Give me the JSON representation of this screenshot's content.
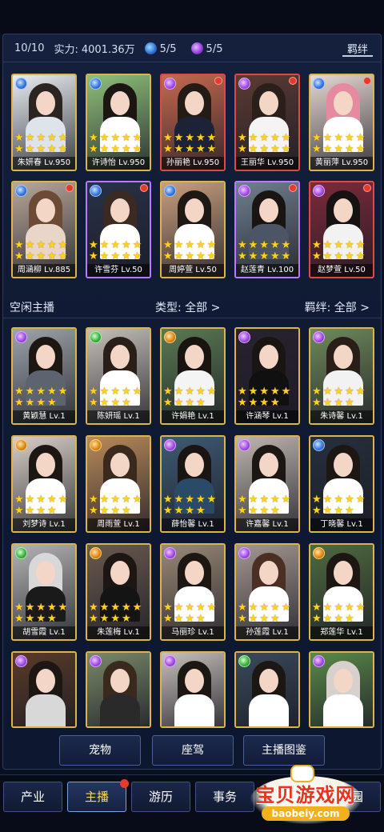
{
  "stats": {
    "count": "10/10",
    "power_label": "实力:",
    "power_value": "4001.36万",
    "blue_count": "5/5",
    "purple_count": "5/5",
    "bond_button": "羁绊"
  },
  "team": [
    {
      "name": "朱妍春 Lv.950",
      "frame": "gold",
      "element": "blue",
      "dot": false,
      "stars": 10,
      "palette": [
        "#e9eef2",
        "#2c2420",
        "#dfe3ea"
      ]
    },
    {
      "name": "许诗怡 Lv.950",
      "frame": "gold",
      "element": "blue",
      "dot": false,
      "stars": 10,
      "palette": [
        "#8fc07a",
        "#1c1612",
        "#ffffff"
      ]
    },
    {
      "name": "孙丽艳 Lv.950",
      "frame": "red",
      "element": "purple",
      "dot": true,
      "stars": 10,
      "palette": [
        "#c56a4e",
        "#241a16",
        "#1d2236"
      ]
    },
    {
      "name": "王丽华 Lv.950",
      "frame": "red",
      "element": "purple",
      "dot": true,
      "stars": 10,
      "palette": [
        "#5a3b33",
        "#2a1f1a",
        "#f4f4f4"
      ]
    },
    {
      "name": "黄丽萍 Lv.950",
      "frame": "gold",
      "element": "blue",
      "dot": true,
      "stars": 10,
      "palette": [
        "#e7d8d2",
        "#e58ba0",
        "#ffffff"
      ]
    },
    {
      "name": "周涵柳 Lv.885",
      "frame": "gold",
      "element": "blue",
      "dot": true,
      "stars": 10,
      "palette": [
        "#b9a89a",
        "#6b4a36",
        "#e9d6c8"
      ]
    },
    {
      "name": "许雪芬 Lv.50",
      "frame": "purple",
      "element": "blue",
      "dot": true,
      "stars": 10,
      "palette": [
        "#283247",
        "#3a2a22",
        "#ffffff"
      ]
    },
    {
      "name": "周婷萱 Lv.50",
      "frame": "gold",
      "element": "blue",
      "dot": false,
      "stars": 10,
      "palette": [
        "#c9a07e",
        "#1e1814",
        "#ffffff"
      ]
    },
    {
      "name": "赵莲青 Lv.100",
      "frame": "purple",
      "element": "purple",
      "dot": true,
      "stars": 10,
      "palette": [
        "#70808f",
        "#1a1512",
        "#4b5566"
      ]
    },
    {
      "name": "赵梦萱 Lv.50",
      "frame": "red",
      "element": "purple",
      "dot": true,
      "stars": 10,
      "palette": [
        "#7d2a3a",
        "#161212",
        "#f2f2f2"
      ]
    }
  ],
  "section": {
    "idle_label": "空闲主播",
    "type_filter": "类型: 全部 >",
    "bond_filter": "羁绊: 全部 >"
  },
  "idle": [
    {
      "name": "黄颖慧 Lv.1",
      "frame": "gold",
      "element": "purple",
      "stars": 9,
      "palette": [
        "#9fa5aa",
        "#1d1714",
        "#5d6470"
      ]
    },
    {
      "name": "陈妍瑶 Lv.1",
      "frame": "gold",
      "element": "green",
      "stars": 9,
      "palette": [
        "#c6c0b8",
        "#2a1f18",
        "#ffffff"
      ]
    },
    {
      "name": "许娟艳 Lv.1",
      "frame": "gold",
      "element": "orange",
      "stars": 9,
      "palette": [
        "#5a7a52",
        "#1a1411",
        "#f4f4f4"
      ]
    },
    {
      "name": "许涵琴 Lv.1",
      "frame": "gold",
      "element": "purple",
      "stars": 9,
      "palette": [
        "#2a2230",
        "#1a1412",
        "#101010"
      ]
    },
    {
      "name": "朱诗馨 Lv.1",
      "frame": "gold",
      "element": "purple",
      "stars": 9,
      "palette": [
        "#6f8a5a",
        "#2a1e18",
        "#f2f2f2"
      ]
    },
    {
      "name": "刘梦诗 Lv.1",
      "frame": "gold",
      "element": "orange",
      "stars": 9,
      "palette": [
        "#d8cfc6",
        "#1d1714",
        "#ffffff"
      ]
    },
    {
      "name": "周雨萱 Lv.1",
      "frame": "gold",
      "element": "orange",
      "stars": 9,
      "palette": [
        "#b98a5a",
        "#3a2a1e",
        "#ffffff"
      ]
    },
    {
      "name": "薛怡馨 Lv.1",
      "frame": "gold",
      "element": "purple",
      "stars": 9,
      "palette": [
        "#3f5a73",
        "#1a1512",
        "#2b4a6a"
      ]
    },
    {
      "name": "许嘉馨 Lv.1",
      "frame": "gold",
      "element": "purple",
      "stars": 9,
      "palette": [
        "#bfb6ad",
        "#1d1714",
        "#ffffff"
      ]
    },
    {
      "name": "丁晓馨 Lv.1",
      "frame": "gold",
      "element": "blue",
      "stars": 9,
      "palette": [
        "#25303c",
        "#1d1714",
        "#ffffff"
      ]
    },
    {
      "name": "胡雪霞 Lv.1",
      "frame": "gold",
      "element": "green",
      "stars": 9,
      "palette": [
        "#b4b4b4",
        "#d8d8d8",
        "#1a1a1a"
      ]
    },
    {
      "name": "朱莲梅 Lv.1",
      "frame": "gold",
      "element": "orange",
      "stars": 9,
      "palette": [
        "#6a5a4e",
        "#1d1714",
        "#141414"
      ]
    },
    {
      "name": "马丽珍 Lv.1",
      "frame": "gold",
      "element": "purple",
      "stars": 9,
      "palette": [
        "#9a8a76",
        "#1d1714",
        "#ffffff"
      ]
    },
    {
      "name": "孙莲霞 Lv.1",
      "frame": "gold",
      "element": "purple",
      "stars": 9,
      "palette": [
        "#a49890",
        "#4a2f22",
        "#ffffff"
      ]
    },
    {
      "name": "郑莲华 Lv.1",
      "frame": "gold",
      "element": "orange",
      "stars": 9,
      "palette": [
        "#4f6a3f",
        "#1d1714",
        "#ffffff"
      ]
    },
    {
      "name": "",
      "frame": "gold",
      "element": "purple",
      "stars": 0,
      "palette": [
        "#5a3b2a",
        "#1d1714",
        "#d8d8d8"
      ]
    },
    {
      "name": "",
      "frame": "gold",
      "element": "purple",
      "stars": 0,
      "palette": [
        "#7a8a6a",
        "#3a2a1e",
        "#2a2a2a"
      ]
    },
    {
      "name": "",
      "frame": "gold",
      "element": "purple",
      "stars": 0,
      "palette": [
        "#c8c0bb",
        "#1d1714",
        "#ffffff"
      ]
    },
    {
      "name": "",
      "frame": "gold",
      "element": "green",
      "stars": 0,
      "palette": [
        "#3a4a5a",
        "#1d1714",
        "#ffffff"
      ]
    },
    {
      "name": "",
      "frame": "gold",
      "element": "purple",
      "stars": 0,
      "palette": [
        "#5a8a4a",
        "#d8d0cc",
        "#ffffff"
      ]
    }
  ],
  "sub_buttons": [
    "宠物",
    "座驾",
    "主播图鉴"
  ],
  "nav": [
    {
      "label": "产业",
      "active": false,
      "dot": false
    },
    {
      "label": "主播",
      "active": true,
      "dot": true
    },
    {
      "label": "游历",
      "active": false,
      "dot": false
    },
    {
      "label": "事务",
      "active": false,
      "dot": false
    },
    {
      "label": "家园",
      "active": false,
      "dot": false
    }
  ],
  "watermark": {
    "title": "宝贝游戏网",
    "url": "baobeiy.com"
  },
  "colors": {
    "gold_frame": "#d9b54a",
    "purple_frame": "#b77bff",
    "red_frame": "#e04848",
    "star": "#ffd21f",
    "active_tab": "#ffd84a"
  }
}
